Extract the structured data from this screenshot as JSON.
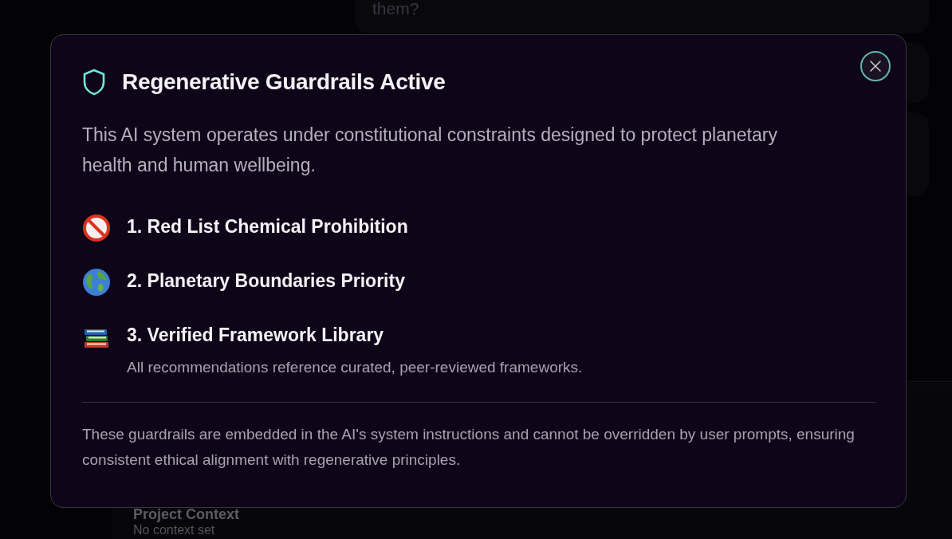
{
  "background": {
    "chat_bubble": "them?",
    "context_panel": {
      "title": "Project Context",
      "value": "No context set"
    }
  },
  "modal": {
    "title": "Regenerative Guardrails Active",
    "description": "This AI system operates under constitutional constraints designed to protect planetary health and human wellbeing.",
    "guardrails": [
      {
        "title": "1. Red List Chemical Prohibition"
      },
      {
        "title": "2. Planetary Boundaries Priority"
      },
      {
        "title": "3. Verified Framework Library",
        "detail": "All recommendations reference curated, peer-reviewed frameworks."
      }
    ],
    "footer": "These guardrails are embedded in the AI's system instructions and cannot be overridden by user prompts, ensuring consistent ethical alignment with regenerative principles."
  }
}
